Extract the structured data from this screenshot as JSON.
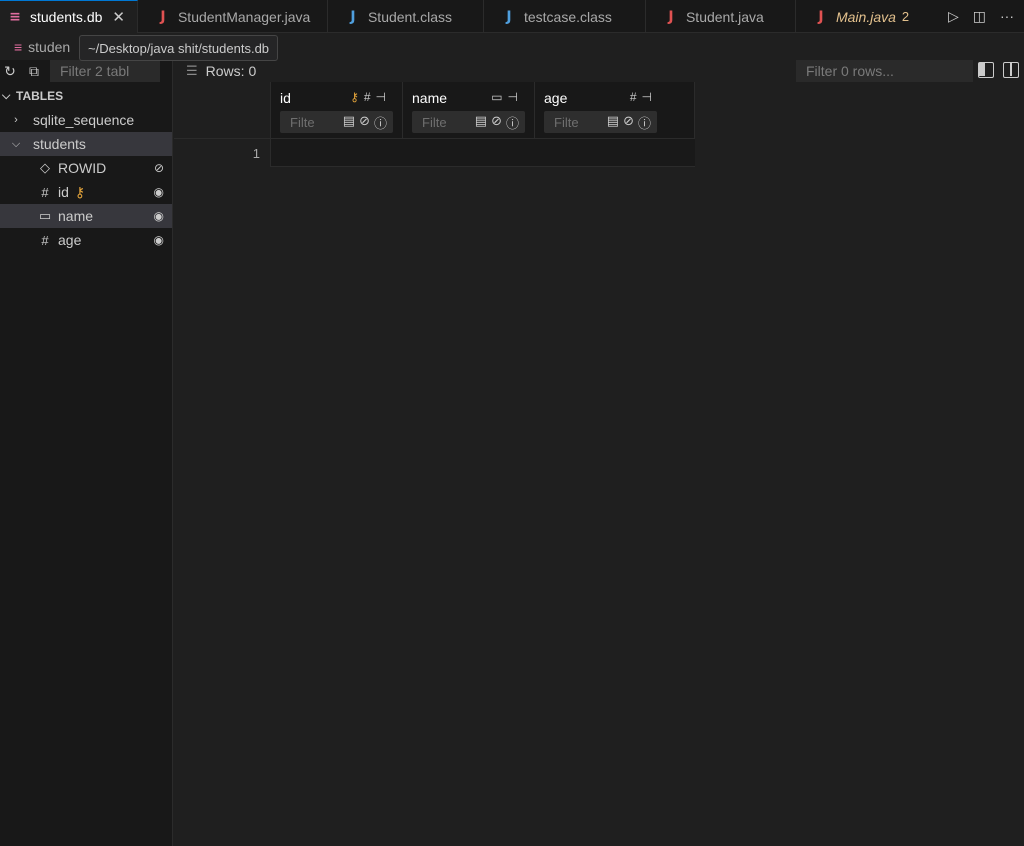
{
  "tabs": [
    {
      "label": "students.db",
      "icon": "database-icon",
      "icon_glyph": "≡",
      "icon_color": "#e06c9f",
      "active": true,
      "close": "✕"
    },
    {
      "label": "StudentManager.java",
      "icon": "java-icon",
      "icon_glyph": "J",
      "icon_color": "#e05252"
    },
    {
      "label": "Student.class",
      "icon": "java-class-icon",
      "icon_glyph": "J",
      "icon_color": "#4f9fde"
    },
    {
      "label": "testcase.class",
      "icon": "java-class-icon",
      "icon_glyph": "J",
      "icon_color": "#4f9fde"
    },
    {
      "label": "Student.java",
      "icon": "java-icon",
      "icon_glyph": "J",
      "icon_color": "#e05252"
    },
    {
      "label": "Main.java",
      "icon": "java-icon",
      "icon_glyph": "J",
      "icon_color": "#e05252",
      "badge": "2",
      "modified": true
    }
  ],
  "tab_actions": {
    "run": "▷",
    "split": "◫",
    "more": "···"
  },
  "breadcrumb": {
    "label": "studen"
  },
  "tooltip": {
    "text": "~/Desktop/java shit/students.db"
  },
  "sidebar": {
    "filter_placeholder": "Filter 2 tabl",
    "section_title": "TABLES",
    "tables": [
      {
        "name": "sqlite_sequence",
        "expanded": false
      },
      {
        "name": "students",
        "expanded": true
      }
    ],
    "columns": [
      {
        "name": "ROWID",
        "icon": "tag-icon",
        "glyph": "◇",
        "visibility": "eye-off-icon",
        "vis_glyph": "⊘"
      },
      {
        "name": "id",
        "icon": "hash-icon",
        "glyph": "#",
        "primary_key": true,
        "visibility": "eye-icon",
        "vis_glyph": "◉"
      },
      {
        "name": "name",
        "icon": "text-icon",
        "glyph": "▭",
        "visibility": "eye-icon",
        "vis_glyph": "◉",
        "selected": true
      },
      {
        "name": "age",
        "icon": "hash-icon",
        "glyph": "#",
        "visibility": "eye-icon",
        "vis_glyph": "◉"
      }
    ]
  },
  "main": {
    "rows_label": "Rows: 0",
    "rows_filter_placeholder": "Filter 0 rows...",
    "grid": {
      "columns": [
        {
          "name": "id",
          "type_glyph": "#",
          "key": true
        },
        {
          "name": "name",
          "type_glyph": "▭",
          "key": false
        },
        {
          "name": "age",
          "type_glyph": "#",
          "key": false
        }
      ],
      "filter_placeholder": "Filte",
      "rows": [
        {
          "num": "1"
        }
      ]
    }
  },
  "colors": {
    "accent": "#0078d4",
    "key": "#e2a33a",
    "modified": "#e2c08d",
    "db": "#e06c9f"
  }
}
